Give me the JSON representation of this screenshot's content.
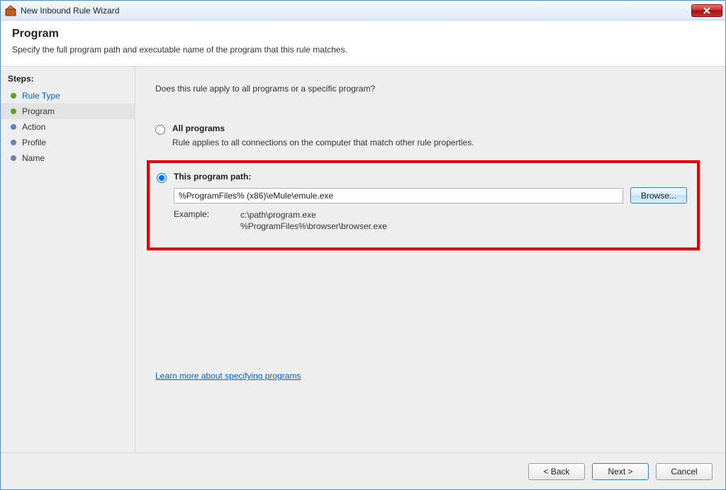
{
  "window": {
    "title": "New Inbound Rule Wizard"
  },
  "header": {
    "title": "Program",
    "subtitle": "Specify the full program path and executable name of the program that this rule matches."
  },
  "sidebar": {
    "steps_label": "Steps:",
    "items": [
      {
        "label": "Rule Type",
        "state": "done link"
      },
      {
        "label": "Program",
        "state": "active"
      },
      {
        "label": "Action",
        "state": ""
      },
      {
        "label": "Profile",
        "state": ""
      },
      {
        "label": "Name",
        "state": ""
      }
    ]
  },
  "content": {
    "question": "Does this rule apply to all programs or a specific program?",
    "option_all": {
      "label": "All programs",
      "desc": "Rule applies to all connections on the computer that match other rule properties."
    },
    "option_path": {
      "label": "This program path:",
      "value": "%ProgramFiles% (x86)\\eMule\\emule.exe",
      "browse": "Browse...",
      "example_label": "Example:",
      "example_line1": "c:\\path\\program.exe",
      "example_line2": "%ProgramFiles%\\browser\\browser.exe"
    },
    "learn_more": "Learn more about specifying programs"
  },
  "footer": {
    "back": "< Back",
    "next": "Next >",
    "cancel": "Cancel"
  }
}
